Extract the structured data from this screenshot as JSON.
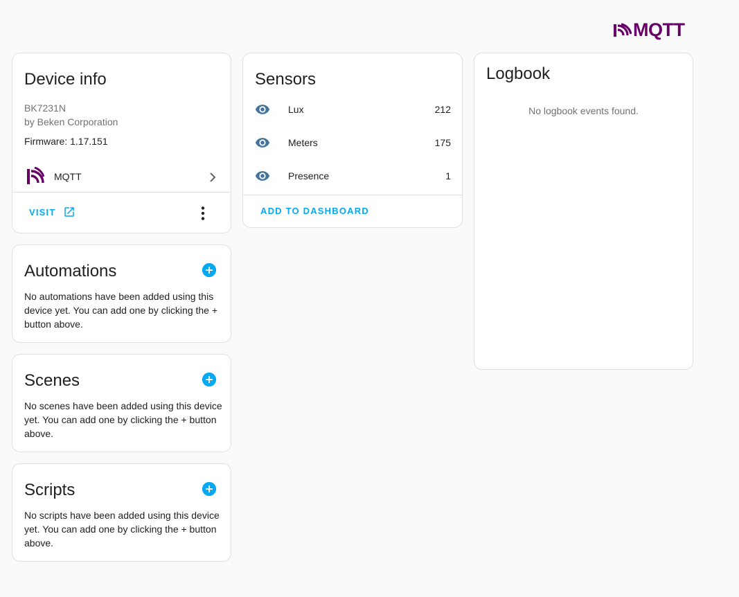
{
  "brand": {
    "name": "MQTT",
    "icon": "mqtt-logo-icon",
    "color": "#660066"
  },
  "device_info": {
    "title": "Device info",
    "model": "BK7231N",
    "manufacturer": "by Beken Corporation",
    "firmware": "Firmware: 1.17.151",
    "integration": {
      "label": "MQTT",
      "icon": "mqtt-logo-icon"
    },
    "visit_label": "VISIT",
    "visit_icon": "open-in-new-icon",
    "more_icon": "dots-vertical-icon"
  },
  "sensors": {
    "title": "Sensors",
    "items": [
      {
        "name": "Lux",
        "value": "212",
        "icon": "eye-icon"
      },
      {
        "name": "Meters",
        "value": "175",
        "icon": "eye-icon"
      },
      {
        "name": "Presence",
        "value": "1",
        "icon": "eye-icon"
      }
    ],
    "add_label": "ADD TO DASHBOARD"
  },
  "logbook": {
    "title": "Logbook",
    "empty_text": "No logbook events found."
  },
  "automations": {
    "title": "Automations",
    "description": "No automations have been added using this device yet. You can add one by clicking the + button above.",
    "add_icon": "plus-circle-icon"
  },
  "scenes": {
    "title": "Scenes",
    "description": "No scenes have been added using this device yet. You can add one by clicking the + button above.",
    "add_icon": "plus-circle-icon"
  },
  "scripts": {
    "title": "Scripts",
    "description": "No scripts have been added using this device yet. You can add one by clicking the + button above.",
    "add_icon": "plus-circle-icon"
  },
  "colors": {
    "accent": "#03a9f4",
    "icon_eye": "#44739e",
    "secondary_text": "#727272"
  }
}
